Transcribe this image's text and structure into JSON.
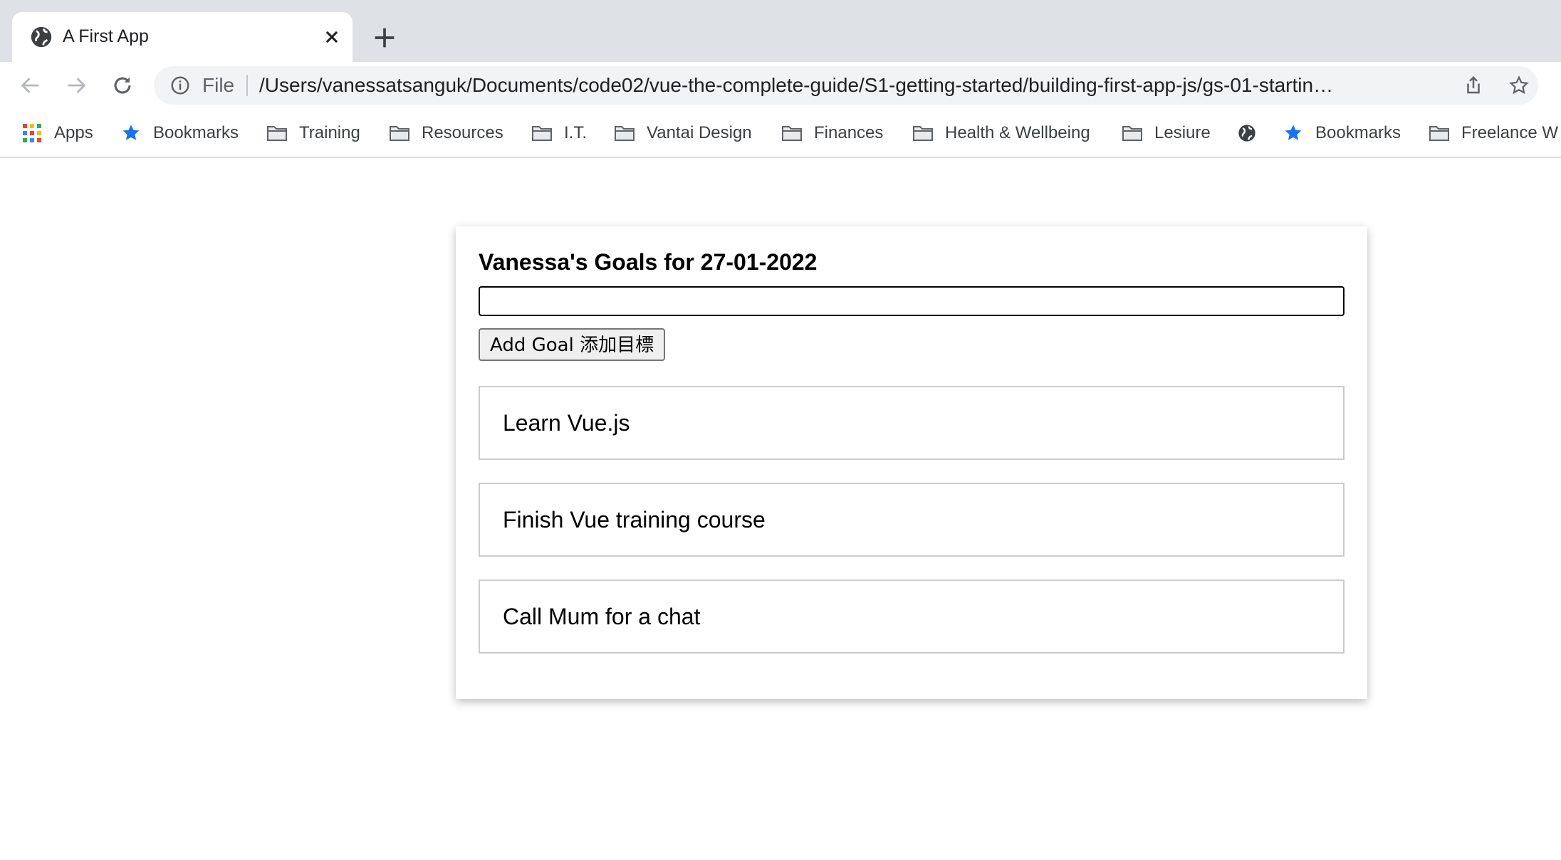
{
  "browser": {
    "tab_title": "A First App",
    "url_scheme": "File",
    "url": "/Users/vanessatsanguk/Documents/code02/vue-the-complete-guide/S1-getting-started/building-first-app-js/gs-01-startin…",
    "bookmarks": [
      {
        "label": "Apps",
        "icon": "apps-grid-icon"
      },
      {
        "label": "Bookmarks",
        "icon": "star-icon"
      },
      {
        "label": "Training",
        "icon": "folder-icon"
      },
      {
        "label": "Resources",
        "icon": "folder-icon"
      },
      {
        "label": "I.T.",
        "icon": "folder-icon"
      },
      {
        "label": "Vantai Design",
        "icon": "folder-icon"
      },
      {
        "label": "Finances",
        "icon": "folder-icon"
      },
      {
        "label": "Health & Wellbeing",
        "icon": "folder-icon"
      },
      {
        "label": "Lesiure",
        "icon": "folder-icon"
      },
      {
        "label": "",
        "icon": "globe-icon"
      },
      {
        "label": "Bookmarks",
        "icon": "star-icon"
      },
      {
        "label": "Freelance W",
        "icon": "folder-icon"
      }
    ]
  },
  "app": {
    "heading": "Vanessa's Goals for 27-01-2022",
    "input_value": "",
    "add_button_label": "Add Goal 添加目標",
    "goals": [
      "Learn Vue.js",
      "Finish Vue training course",
      "Call Mum for a chat"
    ]
  },
  "colors": {
    "tabstrip_bg": "#dee1e6",
    "star_blue": "#1a73e8"
  }
}
